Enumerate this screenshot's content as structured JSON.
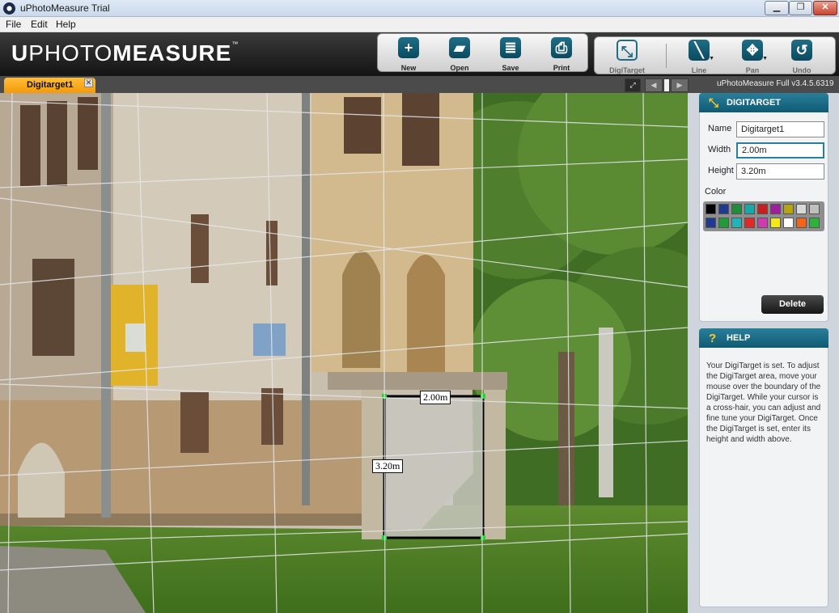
{
  "window": {
    "title": "uPhotoMeasure Trial",
    "min": "▁",
    "max": "❐",
    "close": "✕"
  },
  "menu": [
    "File",
    "Edit",
    "Help"
  ],
  "logo": {
    "bold": "U",
    "light": "PHOTO",
    "bold2": "MEASURE",
    "tm": "™"
  },
  "toolbar_file": [
    {
      "label": "New",
      "icon": "plus-icon",
      "glyph": "+"
    },
    {
      "label": "Open",
      "icon": "folder-icon",
      "glyph": "▰"
    },
    {
      "label": "Save",
      "icon": "save-icon",
      "glyph": "≣"
    },
    {
      "label": "Print",
      "icon": "printer-icon",
      "glyph": "⎙"
    }
  ],
  "toolbar_edit": [
    {
      "label": "DigiTarget",
      "icon": "digitarget-icon",
      "glyph": "⤡"
    },
    {
      "label": "Line",
      "icon": "line-icon",
      "glyph": "╲"
    },
    {
      "label": "Pan",
      "icon": "pan-icon",
      "glyph": "✥"
    },
    {
      "label": "Undo",
      "icon": "undo-icon",
      "glyph": "↺"
    }
  ],
  "tab": {
    "label": "Digitarget1",
    "close": "✕"
  },
  "nav": {
    "prev": "◀",
    "next": "▶"
  },
  "version": "uPhotoMeasure Full v3.4.5.6319",
  "digitarget_overlay": {
    "width_label": "2.00m",
    "height_label": "3.20m"
  },
  "digitarget_panel": {
    "title": "DIGITARGET",
    "icon": "⤡",
    "name_label": "Name",
    "name_value": "Digitarget1",
    "width_label": "Width",
    "width_value": "2.00m",
    "height_label": "Height",
    "height_value": "3.20m",
    "color_label": "Color",
    "colors_row1": [
      "#000000",
      "#1f3a8f",
      "#1e8c3a",
      "#1aa7a8",
      "#c81e1e",
      "#a01e9b",
      "#b5a512",
      "#d8d8d8",
      "#bfbfbf"
    ],
    "colors_row2": [
      "#1f3a8f",
      "#1e9c3a",
      "#20b5b8",
      "#e02a2a",
      "#d03cb0",
      "#f4e81a",
      "#ffffff",
      "#f2641a",
      "#2ab53a"
    ],
    "delete_label": "Delete"
  },
  "help_panel": {
    "title": "HELP",
    "icon": "?",
    "text": "Your DigiTarget is set. To adjust the DigiTarget area, move your mouse over the boundary of the DigiTarget. While your cursor is a cross-hair, you can adjust and fine tune your DigiTarget. Once the DigiTarget is set, enter its height and width above."
  }
}
